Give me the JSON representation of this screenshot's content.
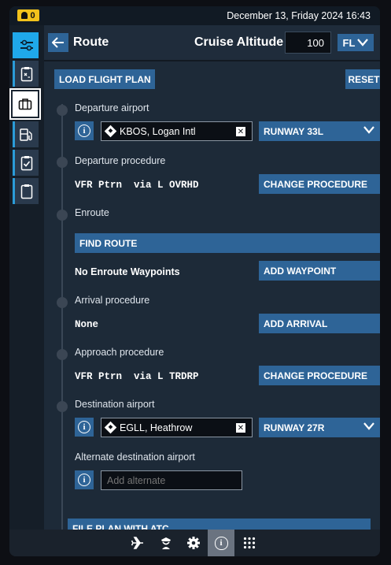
{
  "topbar": {
    "notification_count": "0",
    "datetime": "December 13, Friday 2024 16:43"
  },
  "sidebar": {
    "items": [
      {
        "icon": "sliders-icon",
        "state": "active"
      },
      {
        "icon": "checklist-x-icon",
        "state": "normal"
      },
      {
        "icon": "briefcase-icon",
        "state": "selected"
      },
      {
        "icon": "fuel-payload-icon",
        "state": "normal"
      },
      {
        "icon": "clipboard-check-icon",
        "state": "normal"
      },
      {
        "icon": "clipboard-icon",
        "state": "normal"
      }
    ]
  },
  "header": {
    "title": "Route",
    "cruise_label": "Cruise Altitude",
    "cruise_value": "100",
    "unit": "FL"
  },
  "actions": {
    "load_plan": "LOAD FLIGHT PLAN",
    "reset": "RESET"
  },
  "departure": {
    "label": "Departure airport",
    "airport": "KBOS, Logan Intl",
    "runway": "RUNWAY 33L"
  },
  "departure_procedure": {
    "label": "Departure procedure",
    "value": "VFR Ptrn  via L OVRHD",
    "button": "CHANGE PROCEDURE"
  },
  "enroute": {
    "label": "Enroute",
    "find_route": "FIND ROUTE",
    "value": "No Enroute Waypoints",
    "button": "ADD WAYPOINT"
  },
  "arrival": {
    "label": "Arrival procedure",
    "value": "None",
    "button": "ADD ARRIVAL"
  },
  "approach": {
    "label": "Approach procedure",
    "value": "VFR Ptrn  via L TRDRP",
    "button": "CHANGE PROCEDURE"
  },
  "destination": {
    "label": "Destination airport",
    "airport": "EGLL, Heathrow",
    "runway": "RUNWAY 27R"
  },
  "alternate": {
    "label": "Alternate destination airport",
    "placeholder": "Add alternate"
  },
  "file_plan": "FILE PLAN WITH ATC",
  "bottombar": {
    "icons": [
      "airplane-icon",
      "pilot-icon",
      "gear-icon",
      "info-icon",
      "grid-icon"
    ],
    "active": "info-icon"
  },
  "colors": {
    "accent": "#2e6497",
    "highlight": "#1fa8ea",
    "badge": "#f2c21b"
  }
}
